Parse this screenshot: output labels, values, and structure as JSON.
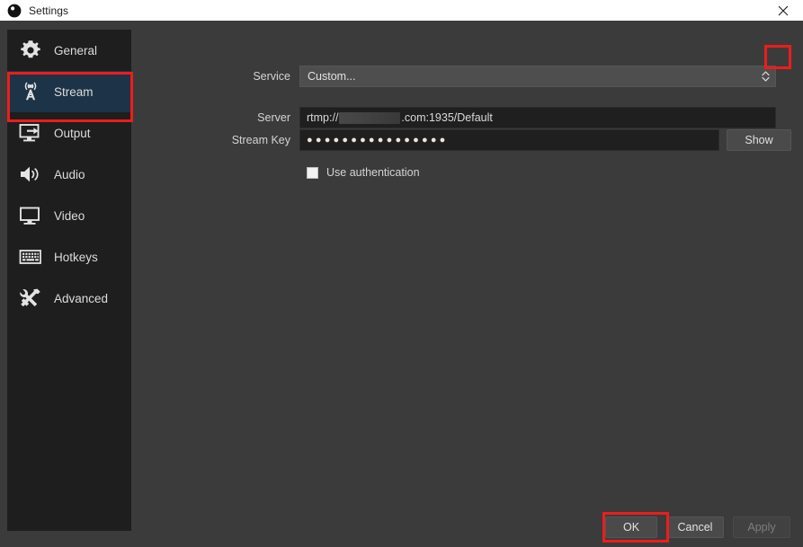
{
  "window": {
    "title": "Settings",
    "logo_icon": "obs-logo-icon",
    "close_icon": "close-icon"
  },
  "colors": {
    "background": "#3b3b3b",
    "sidebar": "#1e1e1e",
    "selected_item": "#1d3348",
    "input_background": "#1f1f1f",
    "combo_background": "#4e4e4e",
    "button": "#4a4a4a",
    "annotation": "#ee1c1c",
    "titlebar": "#ffffff",
    "text": "#d8d8d8"
  },
  "sidebar": {
    "items": [
      {
        "label": "General",
        "icon": "gear-icon",
        "selected": false
      },
      {
        "label": "Stream",
        "icon": "broadcast-icon",
        "selected": true
      },
      {
        "label": "Output",
        "icon": "output-icon",
        "selected": false
      },
      {
        "label": "Audio",
        "icon": "speaker-icon",
        "selected": false
      },
      {
        "label": "Video",
        "icon": "monitor-icon",
        "selected": false
      },
      {
        "label": "Hotkeys",
        "icon": "keyboard-icon",
        "selected": false
      },
      {
        "label": "Advanced",
        "icon": "tools-icon",
        "selected": false
      }
    ]
  },
  "form": {
    "service": {
      "label": "Service",
      "value": "Custom...",
      "arrow_icon": "chevron-updown-icon"
    },
    "server": {
      "label": "Server",
      "value_prefix": "rtmp://",
      "value_suffix": ".com:1935/Default",
      "redacted": true
    },
    "stream_key": {
      "label": "Stream Key",
      "value": "●●●●●●●●●●●●●●●●",
      "show_button_label": "Show"
    },
    "use_authentication": {
      "label": "Use authentication",
      "checked": false
    }
  },
  "buttons": {
    "ok": "OK",
    "cancel": "Cancel",
    "apply": "Apply",
    "apply_disabled": true
  },
  "annotations": [
    {
      "name": "stream-tab-highlight",
      "target": "sidebar-item-stream"
    },
    {
      "name": "service-dropdown-highlight",
      "target": "service-dropdown-arrow"
    },
    {
      "name": "ok-button-highlight",
      "target": "ok-button"
    }
  ]
}
